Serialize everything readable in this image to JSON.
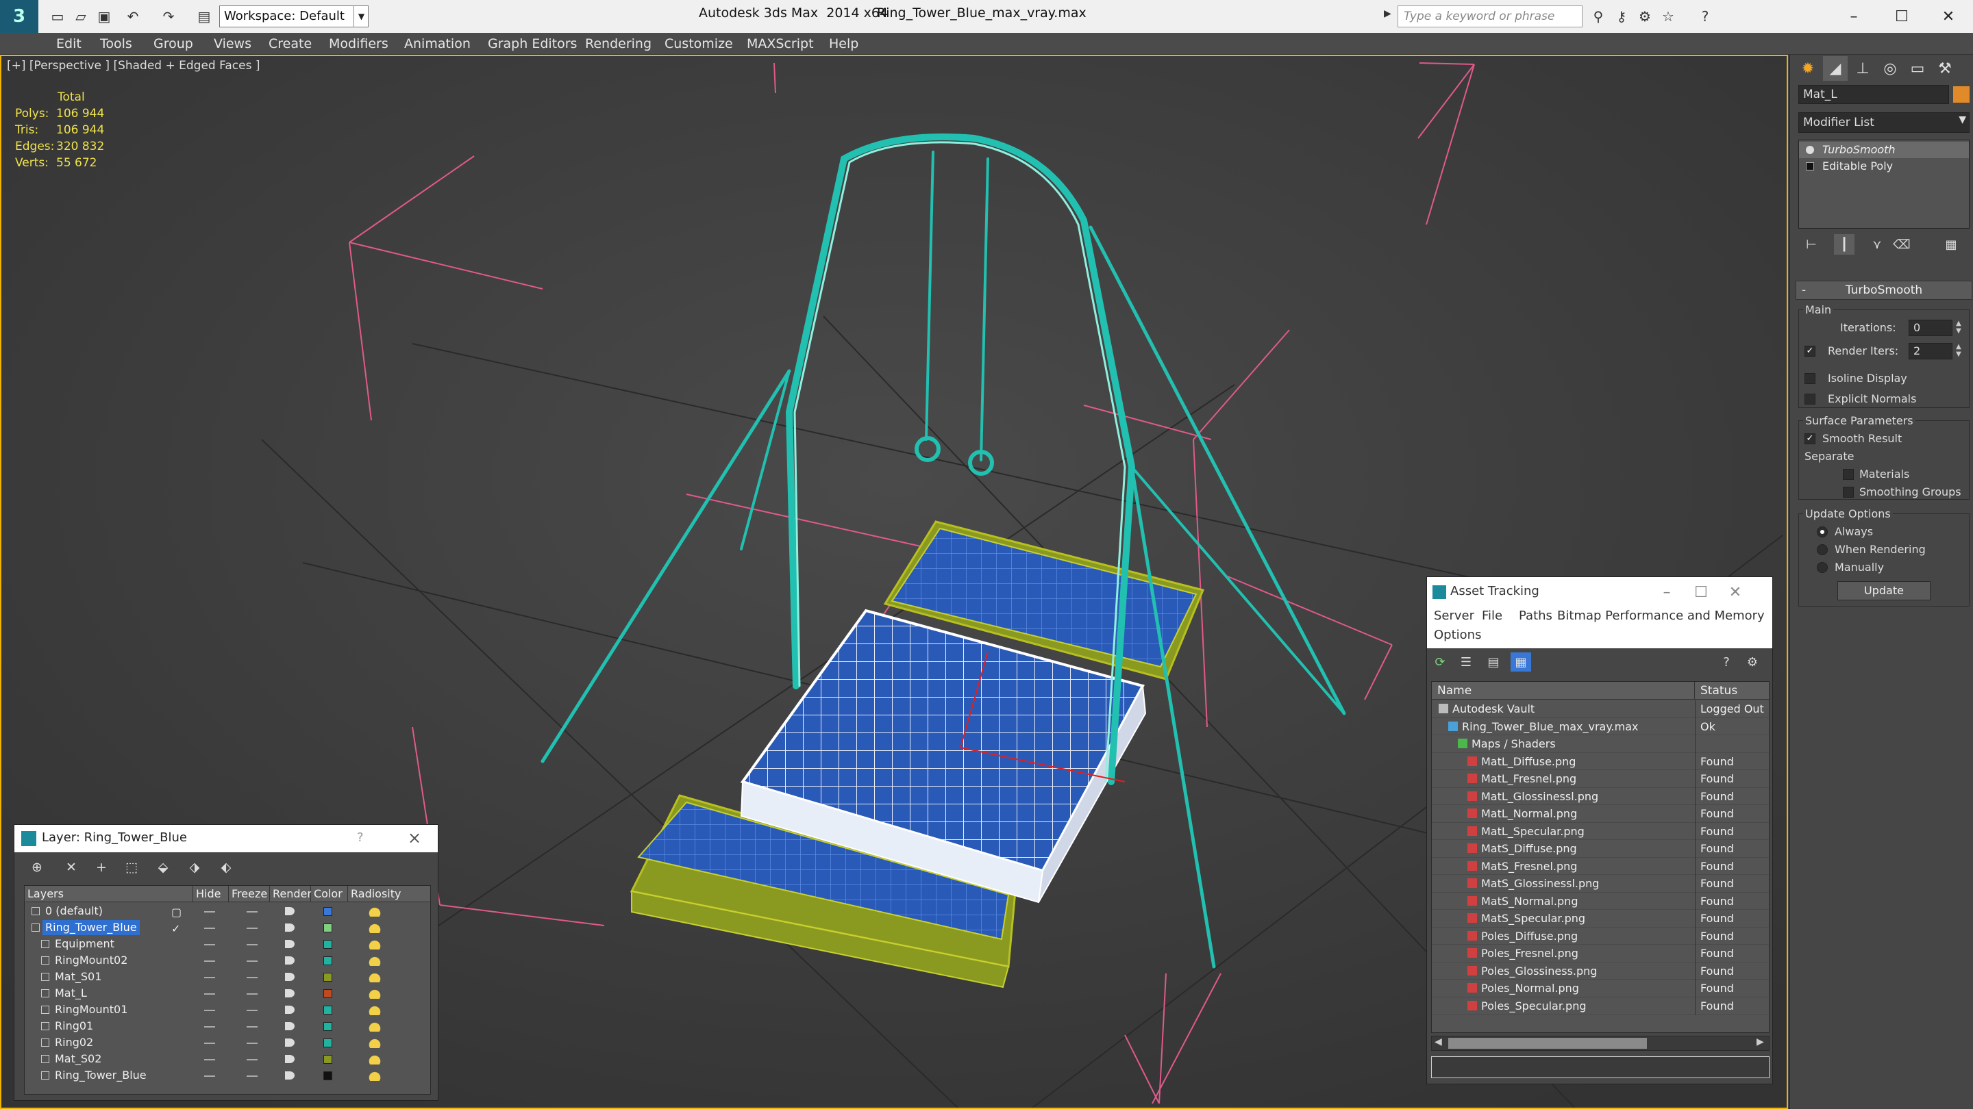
{
  "titlebar": {
    "workspace": "Workspace: Default",
    "app_title": "Autodesk 3ds Max  2014 x64",
    "file_title": "Ring_Tower_Blue_max_vray.max",
    "search_placeholder": "Type a keyword or phrase"
  },
  "menu": [
    "Edit",
    "Tools",
    "Group",
    "Views",
    "Create",
    "Modifiers",
    "Animation",
    "Graph Editors",
    "Rendering",
    "Customize",
    "MAXScript",
    "Help"
  ],
  "viewport": {
    "label": "[+] [Perspective ] [Shaded + Edged Faces ]",
    "stats_header": "Total",
    "stats": [
      {
        "label": "Polys:",
        "value": "106 944"
      },
      {
        "label": "Tris:",
        "value": "106 944"
      },
      {
        "label": "Edges:",
        "value": "320 832"
      },
      {
        "label": "Verts:",
        "value": "55 672"
      }
    ]
  },
  "command_panel": {
    "object_name": "Mat_L",
    "object_color": "#e08a2a",
    "modifier_list": "Modifier List",
    "stack": [
      "TurboSmooth",
      "Editable Poly"
    ],
    "rollout_title": "TurboSmooth",
    "main_group": "Main",
    "iterations_label": "Iterations:",
    "iterations_value": "0",
    "render_iters_label": "Render Iters:",
    "render_iters_value": "2",
    "isoline": "Isoline Display",
    "explicit_normals": "Explicit Normals",
    "surface_group": "Surface Parameters",
    "smooth_result": "Smooth Result",
    "separate": "Separate",
    "materials": "Materials",
    "smoothing_groups": "Smoothing Groups",
    "update_group": "Update Options",
    "always": "Always",
    "when_rendering": "When Rendering",
    "manually": "Manually",
    "update_btn": "Update"
  },
  "layer_dialog": {
    "title": "Layer: Ring_Tower_Blue",
    "help": "?",
    "columns": [
      "Layers",
      "Hide",
      "Freeze",
      "Render",
      "Color",
      "Radiosity"
    ],
    "rows": [
      {
        "name": "0 (default)",
        "indent": 0,
        "color": "#3a78d8"
      },
      {
        "name": "Ring_Tower_Blue",
        "indent": 0,
        "color": "#7fd07f",
        "selected": true
      },
      {
        "name": "Equipment",
        "indent": 1,
        "color": "#22b2a0"
      },
      {
        "name": "RingMount02",
        "indent": 1,
        "color": "#22b2a0"
      },
      {
        "name": "Mat_S01",
        "indent": 1,
        "color": "#8a9a20"
      },
      {
        "name": "Mat_L",
        "indent": 1,
        "color": "#c04a20"
      },
      {
        "name": "RingMount01",
        "indent": 1,
        "color": "#22b2a0"
      },
      {
        "name": "Ring01",
        "indent": 1,
        "color": "#22b2a0"
      },
      {
        "name": "Ring02",
        "indent": 1,
        "color": "#22b2a0"
      },
      {
        "name": "Mat_S02",
        "indent": 1,
        "color": "#8a9a20"
      },
      {
        "name": "Ring_Tower_Blue",
        "indent": 1,
        "color": "#111111"
      }
    ]
  },
  "asset_dialog": {
    "title": "Asset Tracking",
    "menu": [
      "Server",
      "File",
      "Paths",
      "Bitmap Performance and Memory",
      "Options"
    ],
    "columns": [
      "Name",
      "Status"
    ],
    "rows": [
      {
        "name": "Autodesk Vault",
        "status": "Logged Out",
        "indent": 0,
        "icon": "vault"
      },
      {
        "name": "Ring_Tower_Blue_max_vray.max",
        "status": "Ok",
        "indent": 1,
        "icon": "max"
      },
      {
        "name": "Maps / Shaders",
        "status": "",
        "indent": 2,
        "icon": "maps"
      },
      {
        "name": "MatL_Diffuse.png",
        "status": "Found",
        "indent": 3,
        "icon": "png"
      },
      {
        "name": "MatL_Fresnel.png",
        "status": "Found",
        "indent": 3,
        "icon": "png"
      },
      {
        "name": "MatL_Glossinessl.png",
        "status": "Found",
        "indent": 3,
        "icon": "png"
      },
      {
        "name": "MatL_Normal.png",
        "status": "Found",
        "indent": 3,
        "icon": "png"
      },
      {
        "name": "MatL_Specular.png",
        "status": "Found",
        "indent": 3,
        "icon": "png"
      },
      {
        "name": "MatS_Diffuse.png",
        "status": "Found",
        "indent": 3,
        "icon": "png"
      },
      {
        "name": "MatS_Fresnel.png",
        "status": "Found",
        "indent": 3,
        "icon": "png"
      },
      {
        "name": "MatS_Glossinessl.png",
        "status": "Found",
        "indent": 3,
        "icon": "png"
      },
      {
        "name": "MatS_Normal.png",
        "status": "Found",
        "indent": 3,
        "icon": "png"
      },
      {
        "name": "MatS_Specular.png",
        "status": "Found",
        "indent": 3,
        "icon": "png"
      },
      {
        "name": "Poles_Diffuse.png",
        "status": "Found",
        "indent": 3,
        "icon": "png"
      },
      {
        "name": "Poles_Fresnel.png",
        "status": "Found",
        "indent": 3,
        "icon": "png"
      },
      {
        "name": "Poles_Glossiness.png",
        "status": "Found",
        "indent": 3,
        "icon": "png"
      },
      {
        "name": "Poles_Normal.png",
        "status": "Found",
        "indent": 3,
        "icon": "png"
      },
      {
        "name": "Poles_Specular.png",
        "status": "Found",
        "indent": 3,
        "icon": "png"
      }
    ]
  },
  "colors": {
    "accent_viewport_border": "#f0b400",
    "wire_cyan": "#22c0b0",
    "mat_blue": "#2a5ab8",
    "mat_yellow": "#b8c020",
    "selection_blue": "#2f6fd0"
  }
}
